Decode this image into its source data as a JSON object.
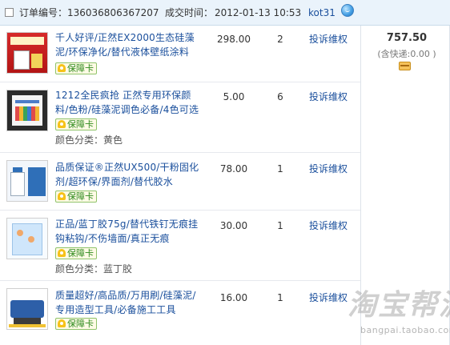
{
  "header": {
    "order_no_label": "订单编号：",
    "order_no": "136036806367207",
    "time_label": "成交时间：",
    "time": "2012-01-13 10:53",
    "buyer": "kot31"
  },
  "order_summary": {
    "total": "757.50",
    "shipping_note": "(含快递:0.00 )"
  },
  "items": [
    {
      "title": "千人好评/正然EX2000生态硅藻泥/环保净化/替代液体壁纸涂料",
      "badge": "保障卡",
      "attribute": "",
      "price": "298.00",
      "quantity": "2",
      "action": "投诉维权"
    },
    {
      "title": "1212全民疯抢 正然专用环保颜料/色粉/硅藻泥调色必备/4色可选",
      "badge": "保障卡",
      "attribute": "颜色分类：黄色",
      "price": "5.00",
      "quantity": "6",
      "action": "投诉维权"
    },
    {
      "title": "品质保证®正然UX500/干粉固化剂/超环保/界面剂/替代胶水",
      "badge": "保障卡",
      "attribute": "",
      "price": "78.00",
      "quantity": "1",
      "action": "投诉维权"
    },
    {
      "title": "正品/蓝丁胶75g/替代铁钉无痕挂钩粘钩/不伤墙面/真正无痕",
      "badge": "保障卡",
      "attribute": "颜色分类：蓝丁胶",
      "price": "30.00",
      "quantity": "1",
      "action": "投诉维权"
    },
    {
      "title": "质量超好/高品质/万用刷/硅藻泥/专用造型工具/必备施工工具",
      "badge": "保障卡",
      "attribute": "",
      "price": "16.00",
      "quantity": "1",
      "action": "投诉维权"
    }
  ],
  "watermark": {
    "text": "淘宝帮派",
    "url": "bangpai.taobao.com"
  },
  "icons": {
    "checkbox": "checkbox-icon",
    "wangwang": "wangwang-chat-icon",
    "payment": "card-icon",
    "guarantee": "guarantee-shield-icon"
  }
}
